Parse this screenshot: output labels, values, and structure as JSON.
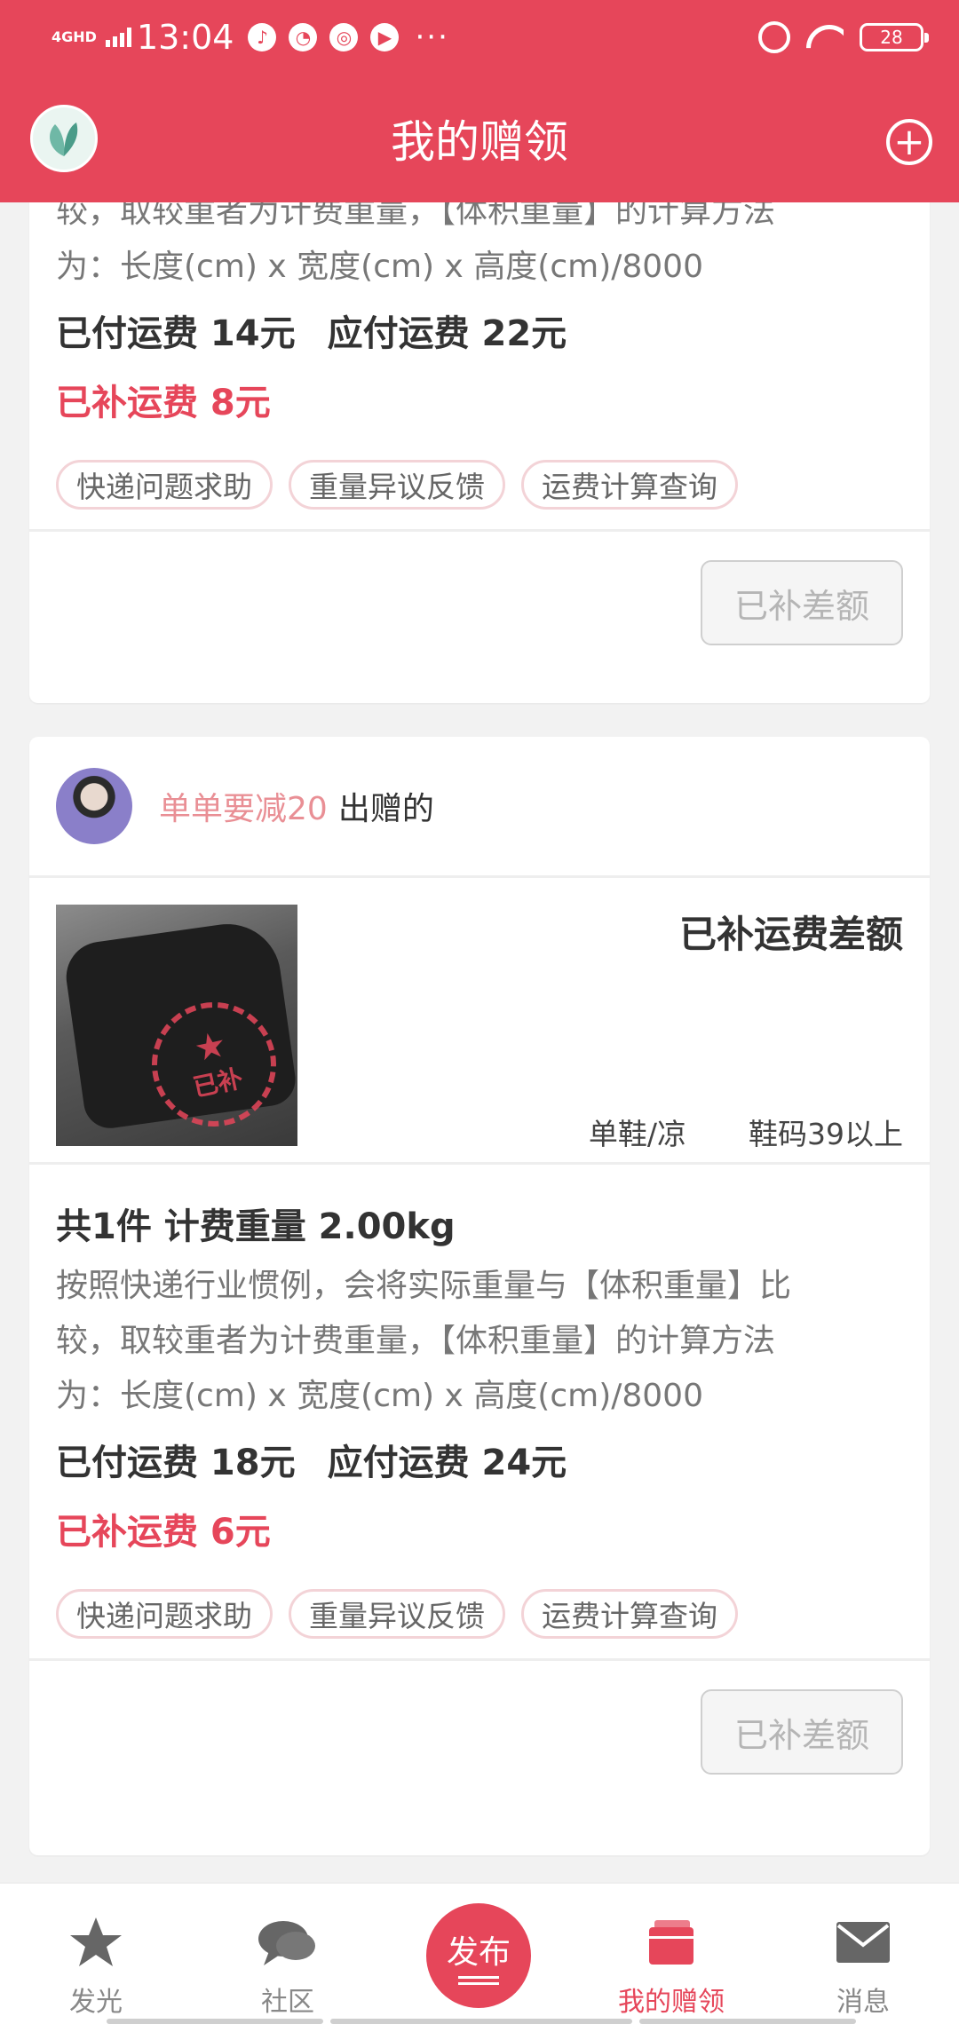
{
  "status_bar": {
    "network": "4GHD",
    "time": "13:04",
    "battery": "28",
    "more": "···",
    "app_icons": [
      "tiktok-icon",
      "speed-icon",
      "wechat-icon",
      "video-icon"
    ]
  },
  "header": {
    "title": "我的赠领",
    "add_icon": "plus-circle-icon"
  },
  "cards": [
    {
      "desc_lines": [
        "较，取较重者为计费重量，【体积重量】的计算方法",
        "为：长度(cm) x 宽度(cm) x 高度(cm)/8000"
      ],
      "paid_fee": "已付运费 14元",
      "due_fee": "应付运费 22元",
      "extra_fee": "已补运费 8元",
      "tags": [
        "快递问题求助",
        "重量异议反馈",
        "运费计算查询"
      ],
      "action_label": "已补差额"
    },
    {
      "giver_name": "单单要减20",
      "giver_action": "出赠的",
      "stamp_text": "已补",
      "status_title": "已补运费差额",
      "attr_category": "单鞋/凉",
      "attr_size": "鞋码39以上",
      "weight": "共1件 计费重量 2.00kg",
      "desc_lines": [
        "按照快递行业惯例，会将实际重量与【体积重量】比",
        "较，取较重者为计费重量，【体积重量】的计算方法",
        "为：长度(cm) x 宽度(cm) x 高度(cm)/8000"
      ],
      "paid_fee": "已付运费 18元",
      "due_fee": "应付运费 24元",
      "extra_fee": "已补运费 6元",
      "tags": [
        "快递问题求助",
        "重量异议反馈",
        "运费计算查询"
      ],
      "action_label": "已补差额"
    }
  ],
  "bottom_nav": {
    "items": [
      {
        "label": "发光",
        "icon": "star-icon"
      },
      {
        "label": "社区",
        "icon": "chat-bubble-icon"
      },
      {
        "label": "发布",
        "icon": "publish-icon"
      },
      {
        "label": "我的赠领",
        "icon": "gift-box-icon"
      },
      {
        "label": "消息",
        "icon": "mail-icon"
      }
    ],
    "active_index": 3
  },
  "colors": {
    "brand": "#e6465a",
    "giver_name": "#e98f95",
    "tag_border": "#f3d3d7"
  }
}
